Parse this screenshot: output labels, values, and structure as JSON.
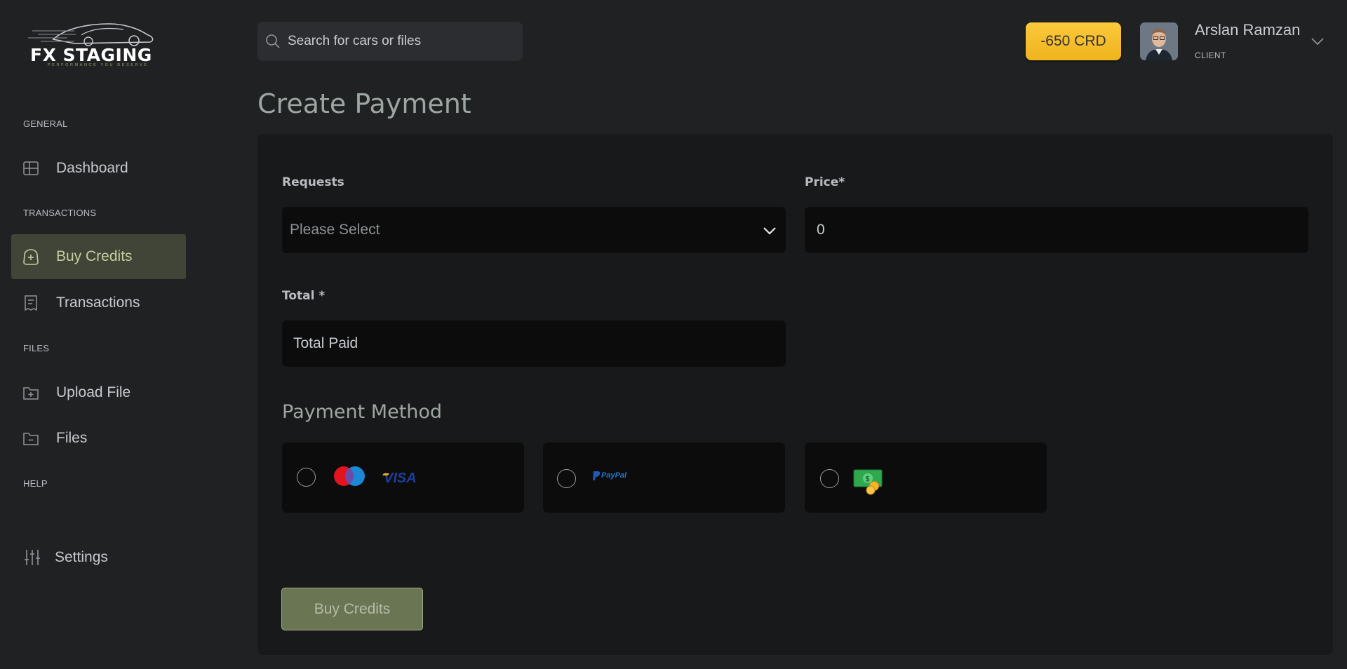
{
  "brand": {
    "logo_text": "FX STAGING",
    "tagline": "PERFORMANCE YOU DESERVE"
  },
  "sidebar": {
    "sections": [
      {
        "label": "GENERAL"
      },
      {
        "label": "TRANSACTIONS"
      },
      {
        "label": "FILES"
      },
      {
        "label": "HELP"
      }
    ],
    "items": [
      {
        "label": "Dashboard",
        "icon": "grid-icon"
      },
      {
        "label": "Buy Credits",
        "icon": "credits-bag-icon",
        "active": true
      },
      {
        "label": "Transactions",
        "icon": "receipt-icon"
      },
      {
        "label": "Upload File",
        "icon": "folder-plus-icon"
      },
      {
        "label": "Files",
        "icon": "folder-minus-icon"
      },
      {
        "label": "Settings",
        "icon": "sliders-icon"
      }
    ]
  },
  "header": {
    "search_placeholder": "Search for cars or files",
    "credits": "-650 CRD",
    "user_name": "Arslan Ramzan",
    "user_role": "CLIENT"
  },
  "page": {
    "title": "Create Payment"
  },
  "form": {
    "requests_label": "Requests",
    "requests_value": "Please Select",
    "price_label": "Price*",
    "price_value": "0",
    "total_label": "Total *",
    "total_value": "Total Paid",
    "payment_method_title": "Payment Method",
    "methods": [
      {
        "name": "card",
        "icons": [
          "mastercard-icon",
          "visa-icon"
        ],
        "label": "VISA"
      },
      {
        "name": "paypal",
        "icons": [
          "paypal-icon"
        ],
        "label": "PayPal"
      },
      {
        "name": "cash",
        "icons": [
          "cash-icon"
        ]
      }
    ],
    "submit_label": "Buy Credits"
  },
  "colors": {
    "accent_active": "#414537",
    "credits_badge": "#f7bf2d",
    "button": "#6a7553"
  }
}
